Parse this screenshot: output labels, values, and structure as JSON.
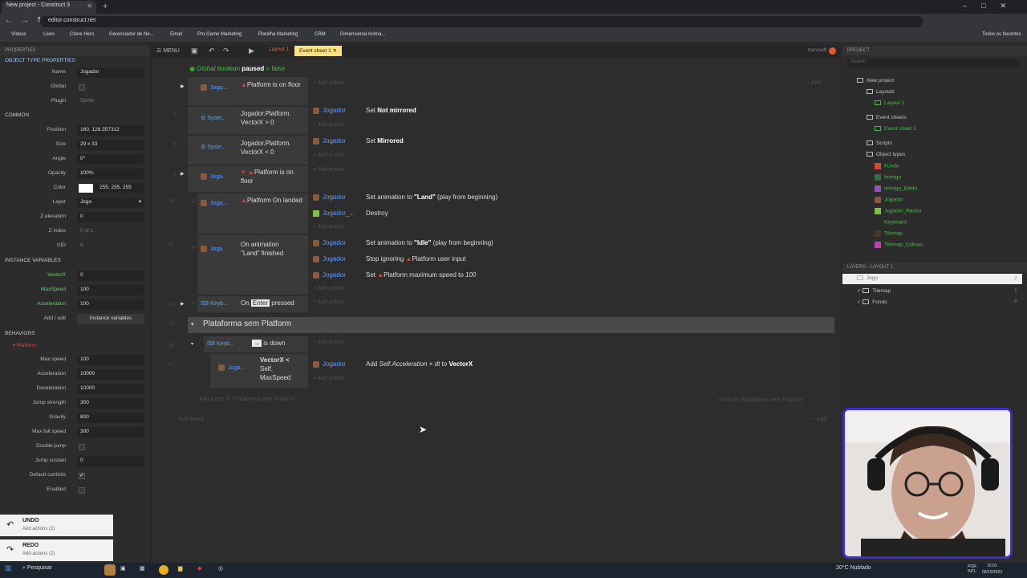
{
  "browser": {
    "tab_title": "New project - Construct 3",
    "url": "editor.construct.net",
    "bookmarks": [
      "Vídeos",
      "Lives",
      "Clone Hero",
      "Gerenciador de Ne...",
      "Email",
      "Pro Game Marketing",
      "Planilha Marketing",
      "CRM",
      "Dimensional Anima..."
    ],
    "favorites_label": "Todos os favoritos"
  },
  "properties": {
    "header": "PROPERTIES",
    "section_object": "OBJECT TYPE PROPERTIES",
    "name_label": "Name",
    "name_value": "Jogador",
    "global_label": "Global",
    "plugin_label": "Plugin",
    "plugin_value": "Sprite",
    "section_common": "COMMON",
    "position_label": "Position",
    "position_value": "160, 128.357312",
    "size_label": "Size",
    "size_value": "29 x 33",
    "angle_label": "Angle",
    "angle_value": "0°",
    "opacity_label": "Opacity",
    "opacity_value": "100%",
    "color_label": "Color",
    "color_value": "255, 255, 255",
    "layer_label": "Layer",
    "layer_value": "Jogo",
    "zelev_label": "Z elevation",
    "zelev_value": "0",
    "zindex_label": "Z index",
    "zindex_value": "0 of 1",
    "uid_label": "UID",
    "uid_value": "6",
    "section_instvars": "INSTANCE VARIABLES",
    "vx_label": "VectorX",
    "vx_value": "0",
    "ms_label": "MaxSpeed",
    "ms_value": "100",
    "acc_label": "Acceleration",
    "acc_value": "100",
    "addedit_label": "Add / edit",
    "addedit_value": "Instance variables",
    "section_behaviors": "BEHAVIORS",
    "platform_label": "Platform",
    "bmax_label": "Max speed",
    "bmax_value": "100",
    "bacc_label": "Acceleration",
    "bacc_value": "10000",
    "bdec_label": "Deceleration",
    "bdec_value": "10000",
    "bjump_label": "Jump strength",
    "bjump_value": "300",
    "bgrav_label": "Gravity",
    "bgrav_value": "800",
    "bfall_label": "Max fall speed",
    "bfall_value": "300",
    "bdj_label": "Double-jump",
    "bjs_label": "Jump sustain",
    "bjs_value": "0",
    "bdc_label": "Default controls",
    "ben_label": "Enabled"
  },
  "undo": {
    "title": "UNDO",
    "sub": "Add actions (2)"
  },
  "redo": {
    "title": "REDO",
    "sub": "Add actions (2)"
  },
  "toolbar": {
    "menu": "MENU",
    "layout_tab": "Layout 1",
    "eventsheet_tab": "Event sheet 1",
    "user": "marcoaft"
  },
  "sheet": {
    "global_var": "Global boolean",
    "global_var_name": "paused",
    "global_var_value": "= false",
    "add_action": "Add action",
    "add": "Add",
    "ev1_obj": "Joga...",
    "ev1_cond": "Platform is on floor",
    "ev2_obj": "Syste...",
    "ev2_cond1": "Jogador.Platform.",
    "ev2_cond2": "VectorX > 0",
    "ev2_act_obj": "Jogador",
    "ev2_act_pre": "Set",
    "ev2_act": "Not mirrored",
    "ev3_obj": "Syste...",
    "ev3_cond1": "Jogador.Platform.",
    "ev3_cond2": "VectorX < 0",
    "ev3_act_obj": "Jogador",
    "ev3_act_pre": "Set",
    "ev3_act": "Mirrored",
    "ev4_obj": "Joga...",
    "ev4_cond": "Platform is on floor",
    "ev5_obj": "Joga...",
    "ev5_cond": "Platform On landed",
    "ev5_act1_obj": "Jogador",
    "ev5_act1": "Set animation to",
    "ev5_act1_b": "\"Land\"",
    "ev5_act1_s": "(play from beginning)",
    "ev5_act2_obj": "Jogador_...",
    "ev5_act2": "Destroy",
    "ev6_obj": "Joga...",
    "ev6_cond1": "On animation",
    "ev6_cond2": "\"Land\" finished",
    "ev6_act1_obj": "Jogador",
    "ev6_act1": "Set animation to",
    "ev6_act1_b": "\"Idle\"",
    "ev6_act1_s": "(play from beginning)",
    "ev6_act2_obj": "Jogador",
    "ev6_act2": "Stop ignoring",
    "ev6_act2_s": "Platform user input",
    "ev6_act3_obj": "Jogador",
    "ev6_act3": "Set",
    "ev6_act3_s": "Platform maximum speed to",
    "ev6_act3_v": "100",
    "ev7_obj": "Keyb...",
    "ev7_pre": "On",
    "ev7_key": "Enter",
    "ev7_post": "pressed",
    "group_title": "Plataforma sem Platform",
    "ev8_obj": "Keyb...",
    "ev8_key": "→",
    "ev8_post": "is down",
    "ev9_obj": "Joga...",
    "ev9_cond1": "VectorX <",
    "ev9_cond2": "Self.",
    "ev9_cond3": "MaxSpeed",
    "ev9_act_obj": "Jogador",
    "ev9_act": "Add",
    "ev9_act_i": "Self.Acceleration × dt",
    "ev9_act_to": "to",
    "ev9_act_b": "VectorX",
    "add_event_group": "Add event to 'Plataforma sem Platform'",
    "add_to_group": "Add to 'Plataforma sem Platform'",
    "add_event": "Add event",
    "nums": [
      "1",
      "5",
      "6",
      "7",
      "10",
      "11",
      "12",
      "15",
      "16",
      "17"
    ]
  },
  "project": {
    "header": "PROJECT",
    "search": "Search",
    "root": "New project",
    "layouts": "Layouts",
    "layout1": "Layout 1",
    "eventsheets": "Event sheets",
    "es1": "Event sheet 1",
    "scripts": "Scripts",
    "objtypes": "Object types",
    "objects": [
      "Fundo",
      "Inimigo",
      "Inimigo_Efeito",
      "Jogador",
      "Jogador_Rastro",
      "Keyboard",
      "Tilemap",
      "Tilemap_Colisao"
    ]
  },
  "layers": {
    "header": "LAYERS - LAYOUT 1",
    "items": [
      {
        "name": "Jogo",
        "n": "2"
      },
      {
        "name": "Tilemap",
        "n": "1"
      },
      {
        "name": "Fundo",
        "n": "0"
      }
    ]
  },
  "taskbar": {
    "search": "Pesquisar",
    "weather": "20°C Nublado",
    "lang": "POR INTL",
    "time": "15:01",
    "date": "06/10/2023"
  }
}
